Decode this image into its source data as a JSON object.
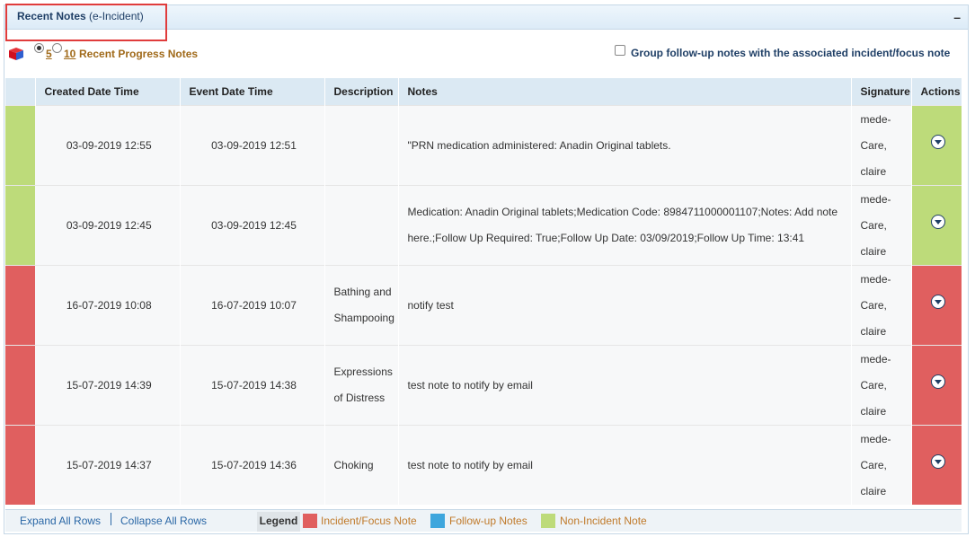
{
  "panel": {
    "title": "Recent Notes",
    "subtitle": "(e-Incident)",
    "collapse_symbol": "–"
  },
  "toolbar": {
    "icon": "cube-icon",
    "option_5": "5",
    "option_10": "10",
    "recent_label": "Recent Progress Notes",
    "group_label": "Group follow-up notes with the associated incident/focus note"
  },
  "columns": [
    "Created Date Time",
    "Event Date Time",
    "Description",
    "Notes",
    "Signature",
    "Actions"
  ],
  "rows": [
    {
      "created": "03-09-2019 12:55",
      "event": "03-09-2019 12:51",
      "description": "",
      "notes": "\"PRN medication administered: Anadin Original tablets.",
      "sig1": "mede-",
      "sig2": "Care,",
      "sig3": "claire",
      "type": "green"
    },
    {
      "created": "03-09-2019 12:45",
      "event": "03-09-2019 12:45",
      "description": "",
      "notes": "Medication: Anadin Original tablets;Medication Code: 8984711000001107;Notes: Add note here.;Follow Up Required: True;Follow Up Date: 03/09/2019;Follow Up Time: 13:41",
      "sig1": "mede-",
      "sig2": "Care,",
      "sig3": "claire",
      "type": "green"
    },
    {
      "created": "16-07-2019 10:08",
      "event": "16-07-2019 10:07",
      "description": "Bathing and Shampooing",
      "notes": "notify test",
      "sig1": "mede-",
      "sig2": "Care,",
      "sig3": "claire",
      "type": "red"
    },
    {
      "created": "15-07-2019 14:39",
      "event": "15-07-2019 14:38",
      "description": "Expressions of Distress",
      "notes": "test note to notify by email",
      "sig1": "mede-",
      "sig2": "Care,",
      "sig3": "claire",
      "type": "red"
    },
    {
      "created": "15-07-2019 14:37",
      "event": "15-07-2019 14:36",
      "description": "Choking",
      "notes": "test note to notify by email",
      "sig1": "mede-",
      "sig2": "Care,",
      "sig3": "claire",
      "type": "red"
    }
  ],
  "footer": {
    "expand": "Expand All Rows",
    "collapse": "Collapse All Rows",
    "legend": "Legend",
    "items": [
      {
        "label": "Incident/Focus Note",
        "color": "#e05f5f"
      },
      {
        "label": "Follow-up Notes",
        "color": "#3ea6dd"
      },
      {
        "label": "Non-Incident Note",
        "color": "#bddb7a"
      }
    ]
  }
}
